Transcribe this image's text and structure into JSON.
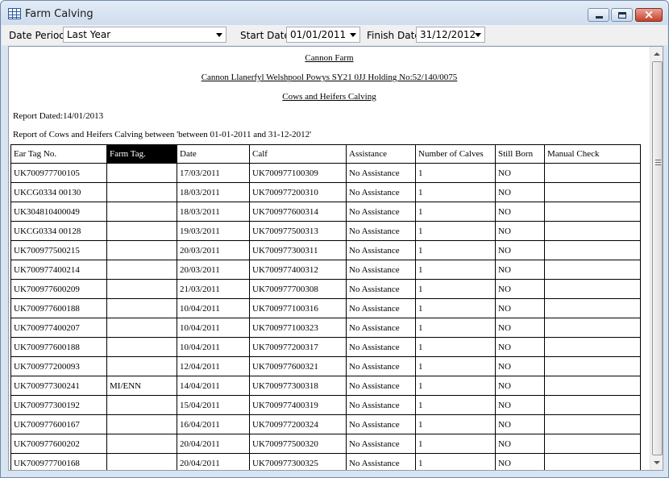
{
  "window": {
    "title": "Farm Calving"
  },
  "toolbar": {
    "date_period_label": "Date Period:",
    "date_period_value": "Last Year",
    "start_date_label": "Start Date:",
    "start_date_value": "01/01/2011",
    "finish_date_label": "Finish Date:",
    "finish_date_value": "31/12/2012"
  },
  "report": {
    "farm_name": "Cannon Farm",
    "address": "Cannon  Llanerfyl Welshpool Powys SY21 0JJ Holding No:52/140/0075",
    "report_title": "Cows and Heifers Calving",
    "report_dated": "Report Dated:14/01/2013",
    "description": "Report  of Cows and Heifers Calving between 'between 01-01-2011 and 31-12-2012'",
    "columns": [
      "Ear Tag No.",
      "Farm Tag.",
      "Date",
      "Calf",
      "Assistance",
      "Number of Calves",
      "Still Born",
      "Manual Check"
    ],
    "rows": [
      [
        "UK700977700105",
        "",
        "17/03/2011",
        "UK700977100309",
        "No Assistance",
        "1",
        "NO",
        ""
      ],
      [
        "UKCG0334 00130",
        "",
        "18/03/2011",
        "UK700977200310",
        "No Assistance",
        "1",
        "NO",
        ""
      ],
      [
        "UK304810400049",
        "",
        "18/03/2011",
        "UK700977600314",
        "No Assistance",
        "1",
        "NO",
        ""
      ],
      [
        "UKCG0334 00128",
        "",
        "19/03/2011",
        "UK700977500313",
        "No Assistance",
        "1",
        "NO",
        ""
      ],
      [
        "UK700977500215",
        "",
        "20/03/2011",
        "UK700977300311",
        "No Assistance",
        "1",
        "NO",
        ""
      ],
      [
        "UK700977400214",
        "",
        "20/03/2011",
        "UK700977400312",
        "No Assistance",
        "1",
        "NO",
        ""
      ],
      [
        "UK700977600209",
        "",
        "21/03/2011",
        "UK700977700308",
        "No Assistance",
        "1",
        "NO",
        ""
      ],
      [
        "UK700977600188",
        "",
        "10/04/2011",
        "UK700977100316",
        "No Assistance",
        "1",
        "NO",
        ""
      ],
      [
        "UK700977400207",
        "",
        "10/04/2011",
        "UK700977100323",
        "No Assistance",
        "1",
        "NO",
        ""
      ],
      [
        "UK700977600188",
        "",
        "10/04/2011",
        "UK700977200317",
        "No Assistance",
        "1",
        "NO",
        ""
      ],
      [
        "UK700977200093",
        "",
        "12/04/2011",
        "UK700977600321",
        "No Assistance",
        "1",
        "NO",
        ""
      ],
      [
        "UK700977300241",
        "MI/ENN",
        "14/04/2011",
        "UK700977300318",
        "No Assistance",
        "1",
        "NO",
        ""
      ],
      [
        "UK700977300192",
        "",
        "15/04/2011",
        "UK700977400319",
        "No Assistance",
        "1",
        "NO",
        ""
      ],
      [
        "UK700977600167",
        "",
        "16/04/2011",
        "UK700977200324",
        "No Assistance",
        "1",
        "NO",
        ""
      ],
      [
        "UK700977600202",
        "",
        "20/04/2011",
        "UK700977500320",
        "No Assistance",
        "1",
        "NO",
        ""
      ],
      [
        "UK700977700168",
        "",
        "20/04/2011",
        "UK700977300325",
        "No Assistance",
        "1",
        "NO",
        ""
      ]
    ]
  }
}
